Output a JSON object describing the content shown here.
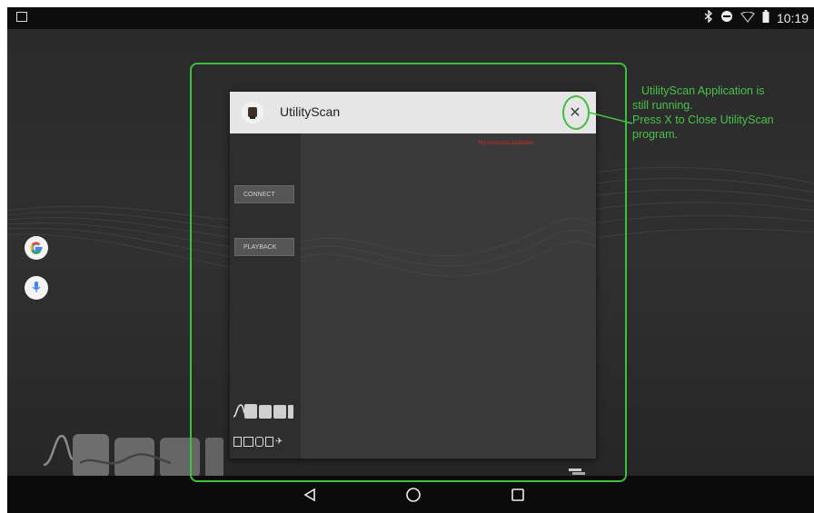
{
  "status_bar": {
    "time": "10:19",
    "icons": [
      "image-notification-icon",
      "bluetooth-icon",
      "do-not-disturb-icon",
      "wifi-icon",
      "battery-icon"
    ]
  },
  "home_screen": {
    "shortcuts": [
      "google-search-icon",
      "voice-search-icon"
    ],
    "wallpaper_logo": "GSSI"
  },
  "recent_app_card": {
    "title": "UtilityScan",
    "close_glyph": "✕",
    "buttons": {
      "connect": "CONNECT",
      "playback": "PLAYBACK"
    },
    "warning": "No Antennas available.",
    "logo": "GSSI"
  },
  "nav_bar": {
    "buttons": [
      "back-icon",
      "home-icon",
      "recents-icon"
    ]
  },
  "annotation": {
    "lines": [
      "UtilityScan Application is",
      "still running.",
      "Press X to Close UtilityScan",
      "program."
    ],
    "color": "#49c24a"
  },
  "colors": {
    "header_bg": "#e6e6e6",
    "warning_red": "#d42a20",
    "annotation_green": "#3fbf3f"
  }
}
